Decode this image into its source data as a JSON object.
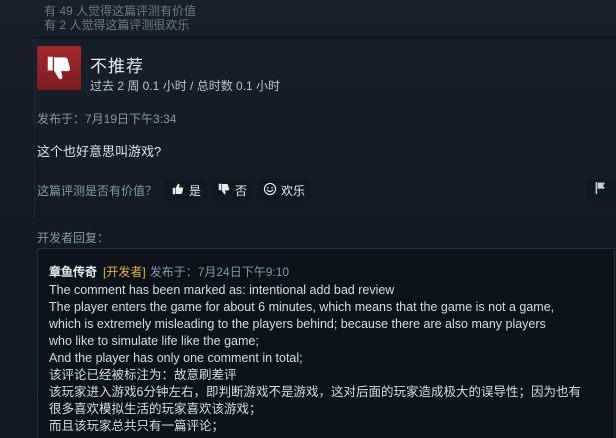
{
  "stats": {
    "helpful_count": "有 49 人觉得这篇评测有价值",
    "funny_count": "有 2 人觉得这篇评测很欢乐"
  },
  "review": {
    "verdict": "不推荐",
    "verdict_icon": "thumbs-down-icon",
    "playtime": "过去 2 周 0.1 小时 / 总时数 0.1 小时",
    "posted": "发布于：7月19日下午3:34",
    "content": "这个也好意思叫游戏?"
  },
  "helpful": {
    "question": "这篇评测是否有价值？",
    "yes_label": "是",
    "no_label": "否",
    "funny_label": "欢乐"
  },
  "developer_response": {
    "label": "开发者回复：",
    "author": "章鱼传奇",
    "tag": "[开发者]",
    "posted": "发布于：7月24日下午9:10",
    "lines": [
      "The comment has been marked as: intentional add bad review",
      "The player enters the game for about 6 minutes, which means that the game is not a game,",
      "which is extremely misleading to the players behind; because there are also many players",
      "who like to simulate life like the game;",
      "And the player has only one comment in total;",
      "该评论已经被标注为：故意刷差评",
      "该玩家进入游戏6分钟左右，即判断游戏不是游戏，这对后面的玩家造成极大的误导性；因为也有",
      "很多喜欢模拟生活的玩家喜欢该游戏；",
      "而且该玩家总共只有一篇评论；"
    ]
  },
  "colors": {
    "negative_accent": "#a3282f",
    "developer_tag": "#e5b534"
  }
}
